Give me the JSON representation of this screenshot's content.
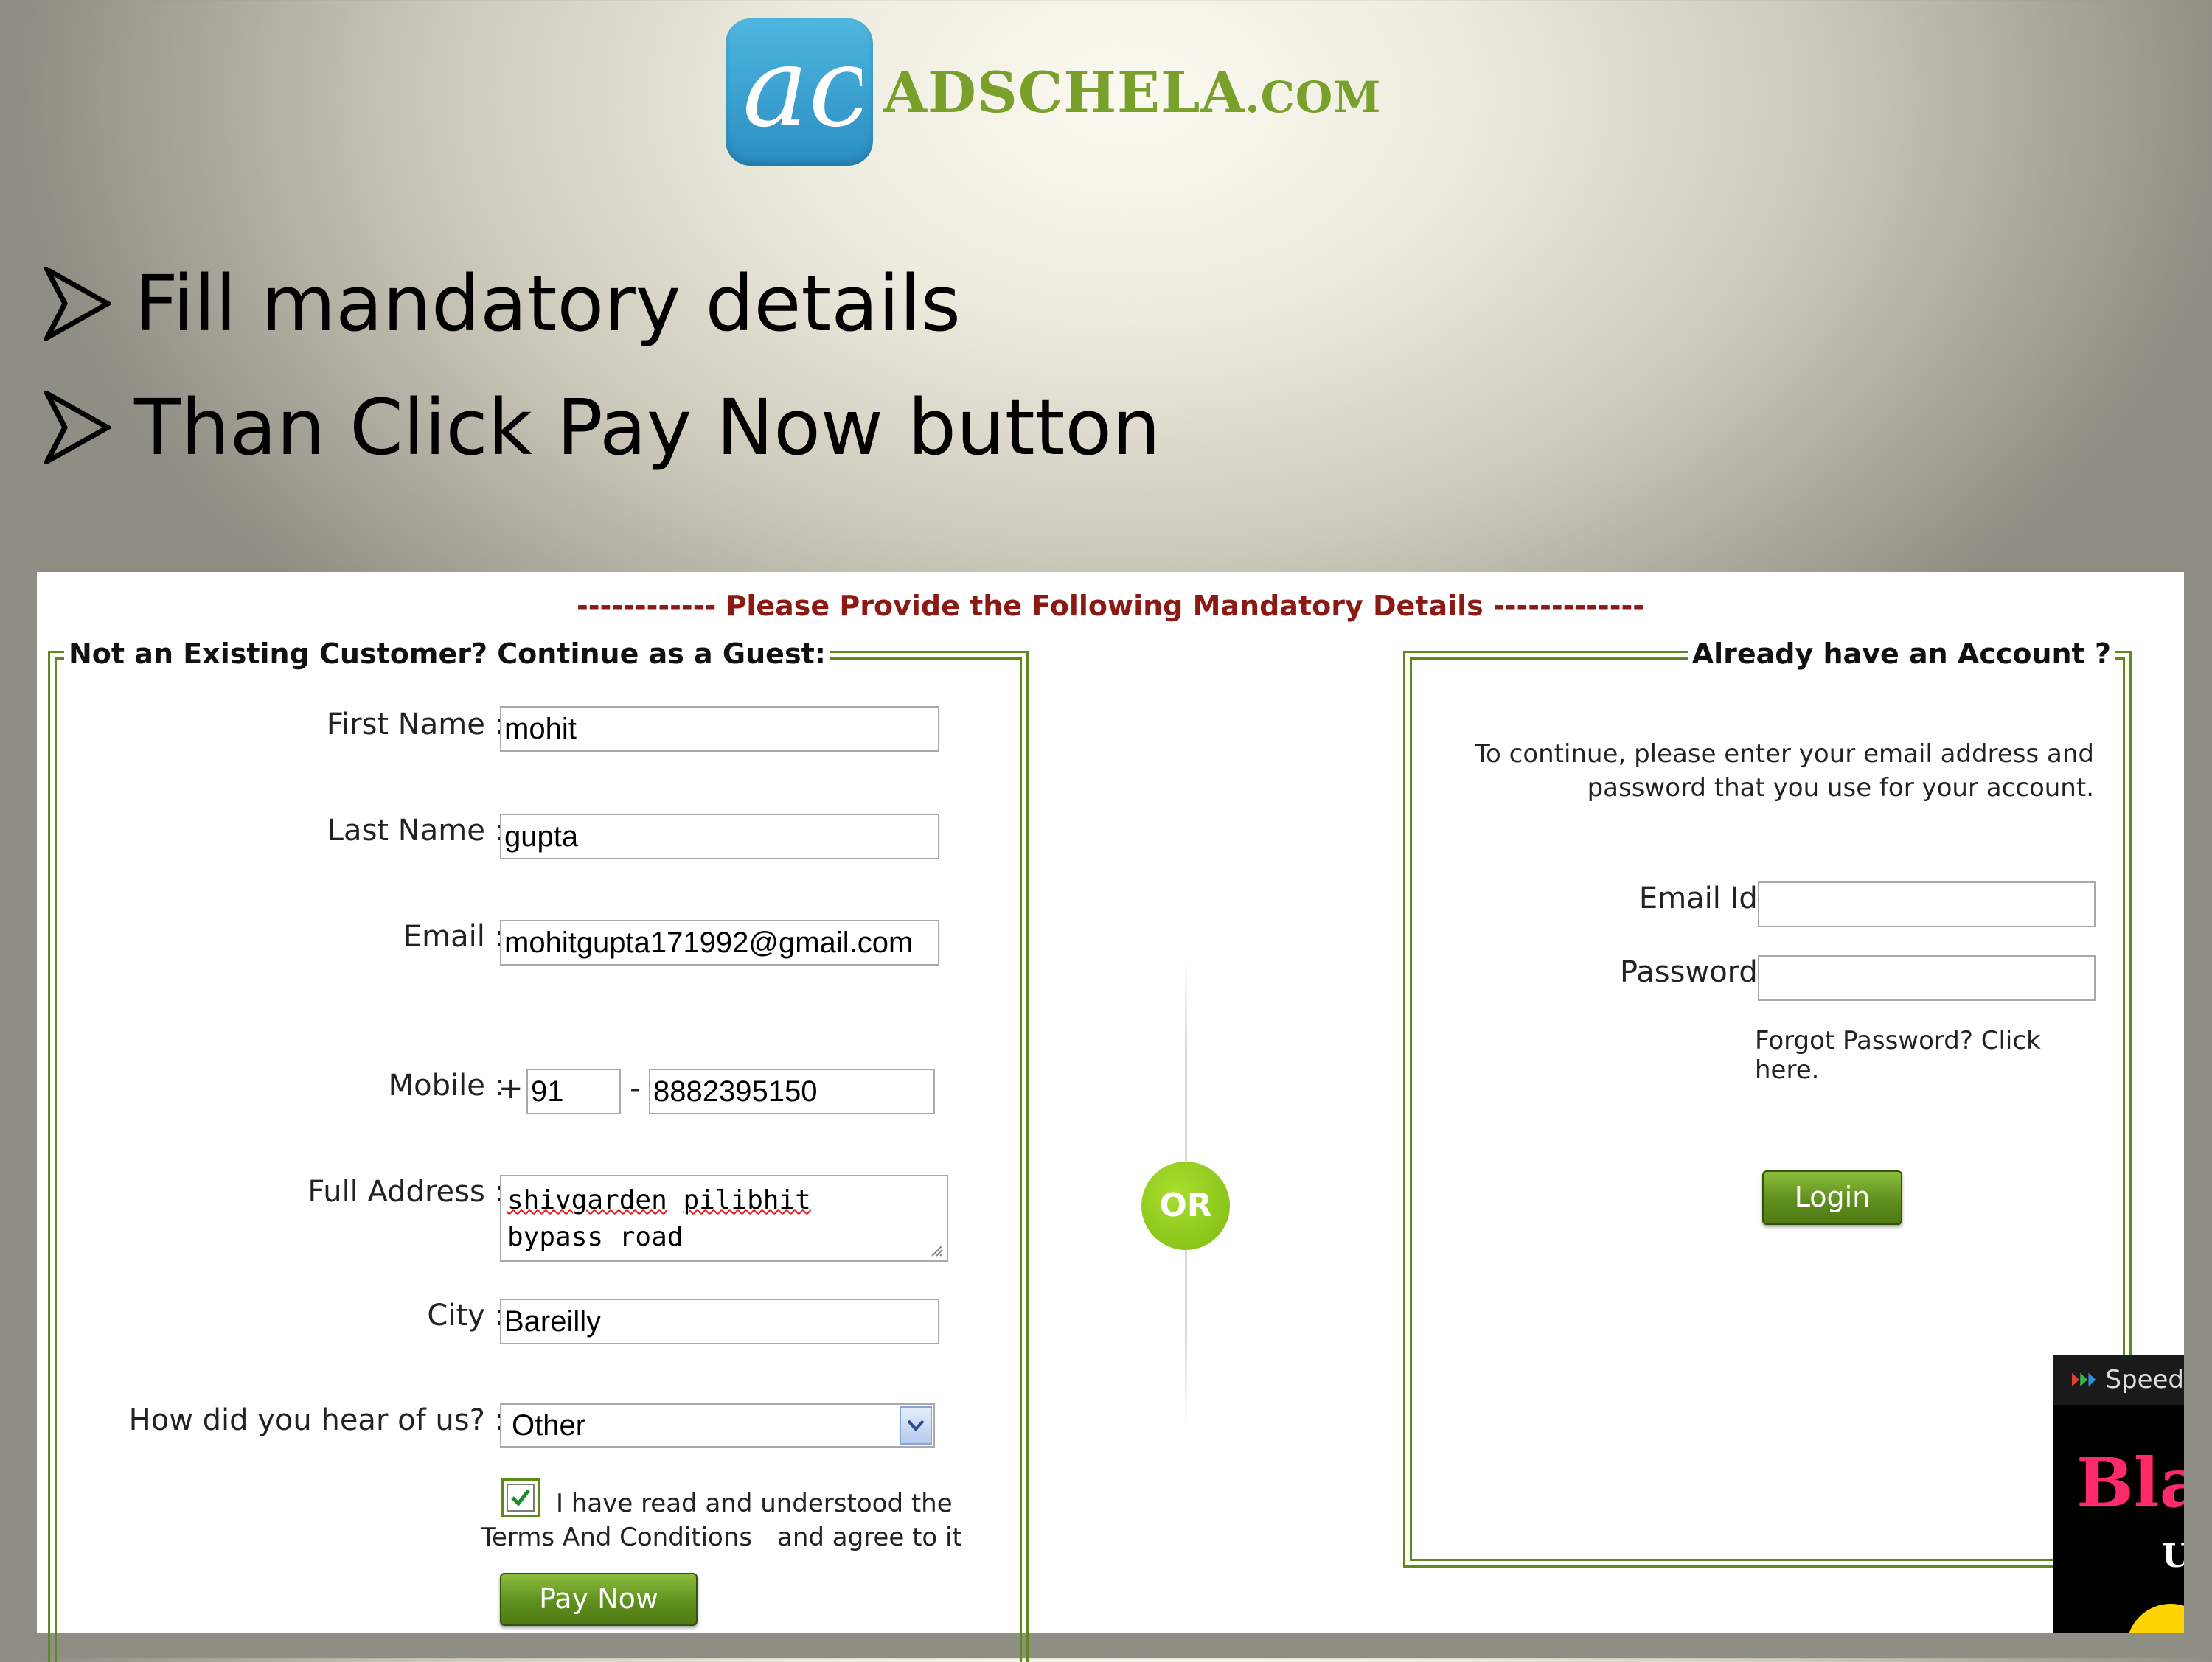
{
  "brand": {
    "logo_mark_text": "ac",
    "name_main": "ADSCHELA",
    "name_domain": ".COM",
    "color": "#79a02b"
  },
  "bullets": [
    "Fill mandatory details",
    "Than Click Pay Now button"
  ],
  "form": {
    "heading": "------------ Please Provide the Following Mandatory Details -------------",
    "heading_color": "#8c1a14",
    "guest": {
      "legend": "Not an Existing Customer? Continue as a Guest:",
      "first_name_label": "First Name :",
      "first_name_value": "mohit",
      "last_name_label": "Last Name :",
      "last_name_value": "gupta",
      "email_label": "Email :",
      "email_value": "mohitgupta171992@gmail.com",
      "mobile_label": "Mobile :",
      "mobile_plus": "+",
      "mobile_code": "91",
      "mobile_dash": "-",
      "mobile_number": "8882395150",
      "address_label": "Full Address :",
      "address_line1_a": "shivgarden",
      "address_line1_b": "pilibhit",
      "address_line2": "bypass road",
      "city_label": "City :",
      "city_value": "Bareilly",
      "hear_label": "How did you hear of us? :",
      "hear_value": "Other",
      "terms_checked": true,
      "terms_line1": "I have read and understood the",
      "terms_link": "Terms And Conditions",
      "terms_line2": "and agree to it",
      "pay_button": "Pay Now"
    },
    "or_label": "OR",
    "account": {
      "legend": "Already have an Account ?",
      "intro_line1": "To continue, please enter your email address and",
      "intro_line2": "password that you use for your account.",
      "email_label": "Email Id :",
      "email_value": "",
      "password_label": "Password :",
      "password_value": "",
      "forgot_line1": "Forgot Password? Click",
      "forgot_line2": "here.",
      "login_button": "Login"
    },
    "accent_color": "#5e8a1b"
  },
  "ad": {
    "speed_label": "Speed",
    "bla_text": "Bla",
    "u_text": "U"
  }
}
